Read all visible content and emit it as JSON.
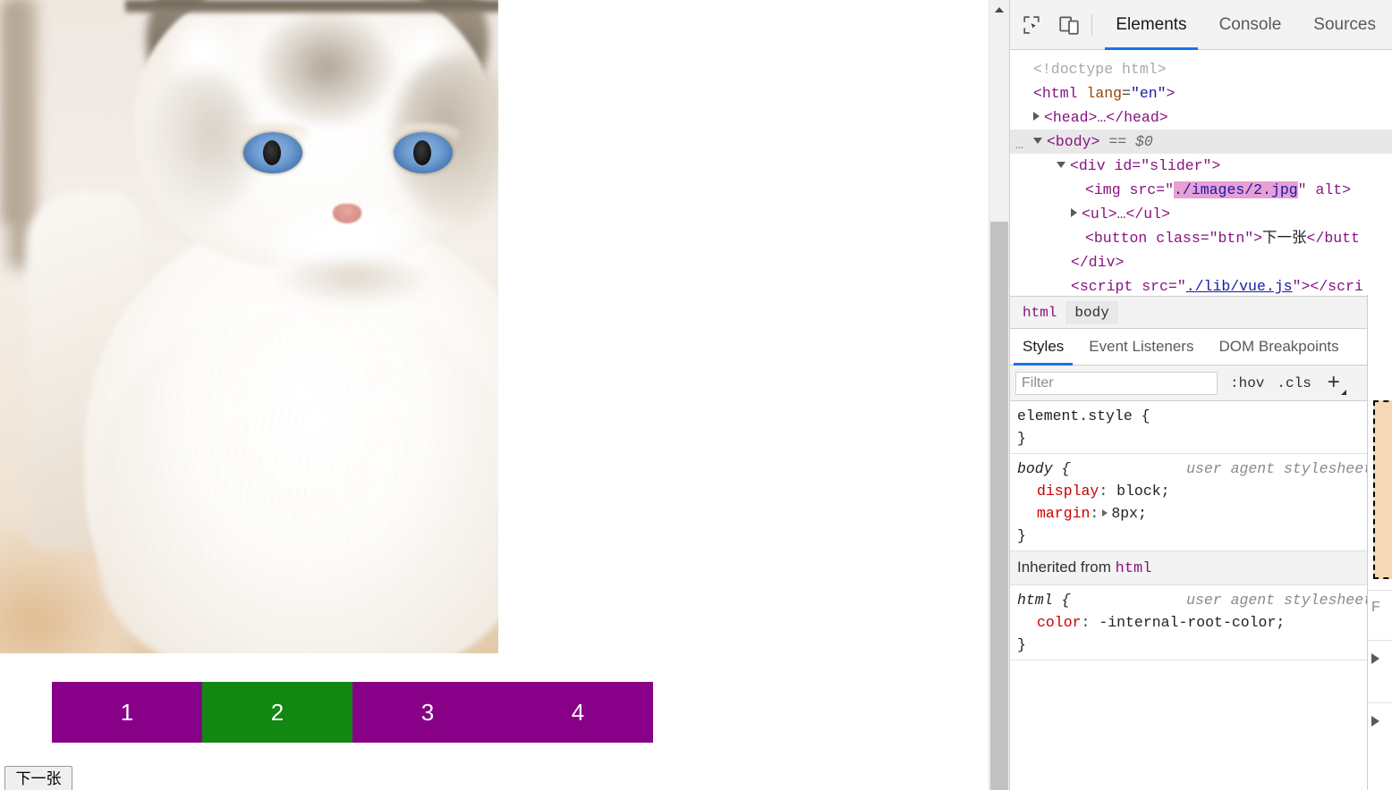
{
  "page": {
    "image": {
      "alt": "",
      "src_shown_in_devtools": "./images/2.jpg",
      "subject": "white ragdoll cat with blue eyes"
    },
    "thumbnails": [
      {
        "label": "1",
        "active": false
      },
      {
        "label": "2",
        "active": true
      },
      {
        "label": "3",
        "active": false
      },
      {
        "label": "4",
        "active": false
      }
    ],
    "next_button_label": "下一张",
    "colors": {
      "thumb_inactive": "#870087",
      "thumb_active": "#118811",
      "thumb_text": "#ffffff"
    }
  },
  "scrollbar": {
    "up_arrow_icon": "triangle-up-icon",
    "thumb_icon": "scrollbar-thumb"
  },
  "devtools": {
    "toolbar": {
      "inspect_icon": "inspect-element-icon",
      "device_icon": "device-toolbar-icon"
    },
    "tabs": [
      {
        "label": "Elements",
        "active": true
      },
      {
        "label": "Console",
        "active": false
      },
      {
        "label": "Sources",
        "active": false
      }
    ],
    "dom": {
      "doctype": "<!doctype html>",
      "html_open": "<html lang=\"en\">",
      "head_collapsed": "<head>…</head>",
      "body_open": "<body>",
      "body_marker": "== $0",
      "slider_open": "<div id=\"slider\">",
      "img_prefix": "<img src=\"",
      "img_src": "./images/2.jpg",
      "img_suffix": "\" alt>",
      "ul_collapsed": "<ul>…</ul>",
      "button_prefix": "<button class=\"btn\">",
      "button_text": "下一张",
      "button_suffix": "</butt",
      "div_close": "</div>",
      "script_prefix": "<script src=\"",
      "script_src": "./lib/vue.js",
      "script_suffix": "\"></scri",
      "ellipsis": "…"
    },
    "breadcrumbs": [
      {
        "label": "html",
        "selected": false
      },
      {
        "label": "body",
        "selected": true
      }
    ],
    "sidebar_tabs": [
      {
        "label": "Styles",
        "active": true
      },
      {
        "label": "Event Listeners",
        "active": false
      },
      {
        "label": "DOM Breakpoints",
        "active": false
      }
    ],
    "filter": {
      "placeholder": "Filter",
      "value": "",
      "hov_label": ":hov",
      "cls_label": ".cls",
      "new_rule_icon": "plus-icon"
    },
    "rules": [
      {
        "selector": "element.style {",
        "origin": "",
        "declarations": [],
        "close": "}"
      },
      {
        "selector": "body {",
        "origin": "user agent stylesheet",
        "declarations": [
          {
            "prop": "display",
            "value": "block;",
            "expandable": false
          },
          {
            "prop": "margin",
            "value": "8px;",
            "expandable": true
          }
        ],
        "close": "}"
      }
    ],
    "inherited_header": {
      "text": "Inherited from",
      "element": "html"
    },
    "inherited_rules": [
      {
        "selector": "html {",
        "origin": "user agent stylesheet",
        "declarations": [
          {
            "prop": "color",
            "value": "-internal-root-color;",
            "expandable": false
          }
        ],
        "close": "}"
      }
    ],
    "computed_pane": {
      "filter_placeholder": "F",
      "box_model_icon": "box-model-diagram"
    }
  }
}
